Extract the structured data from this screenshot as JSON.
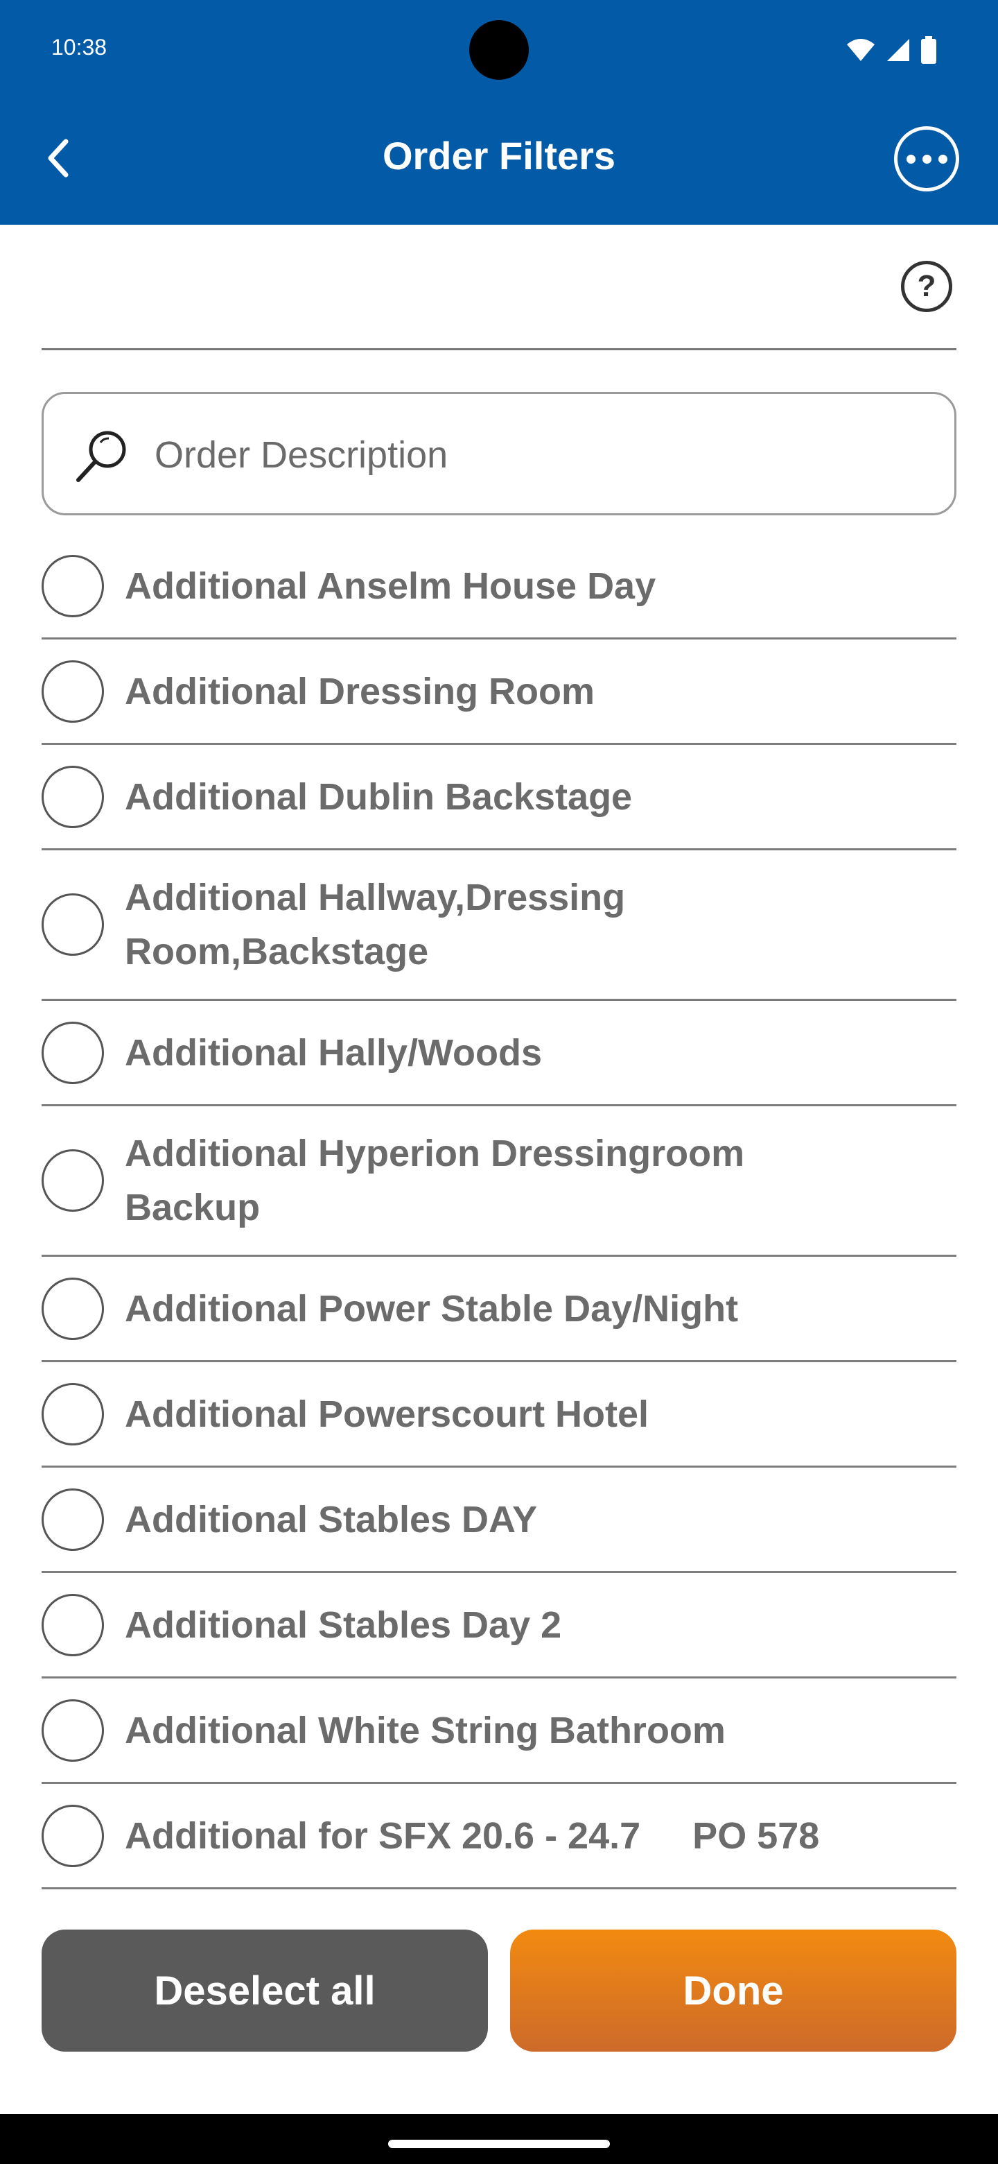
{
  "status_bar": {
    "time": "10:38"
  },
  "header": {
    "title": "Order Filters",
    "background_color": "#035aa6"
  },
  "search": {
    "placeholder": "Order Description",
    "value": ""
  },
  "filters": [
    {
      "label": "Additional Anselm House Day",
      "selected": false
    },
    {
      "label": "Additional Dressing Room",
      "selected": false
    },
    {
      "label": "Additional Dublin Backstage",
      "selected": false
    },
    {
      "label": "Additional Hallway,Dressing Room,Backstage",
      "selected": false
    },
    {
      "label": "Additional Hally/Woods",
      "selected": false
    },
    {
      "label": "Additional Hyperion Dressingroom Backup",
      "selected": false
    },
    {
      "label": "Additional Power Stable Day/Night",
      "selected": false
    },
    {
      "label": "Additional Powerscourt Hotel",
      "selected": false
    },
    {
      "label": "Additional Stables DAY",
      "selected": false
    },
    {
      "label": "Additional Stables Day 2",
      "selected": false
    },
    {
      "label": "Additional White String Bathroom",
      "selected": false
    },
    {
      "label": "Additional for SFX 20.6 - 24.7     PO 578",
      "selected": false
    }
  ],
  "buttons": {
    "deselect_all": "Deselect all",
    "done": "Done",
    "deselect_color": "#5a5a5a",
    "done_color": "#f28a10"
  },
  "icons": {
    "back": "chevron-left-icon",
    "more": "more-horizontal-icon",
    "help": "help-icon",
    "search": "search-icon"
  }
}
